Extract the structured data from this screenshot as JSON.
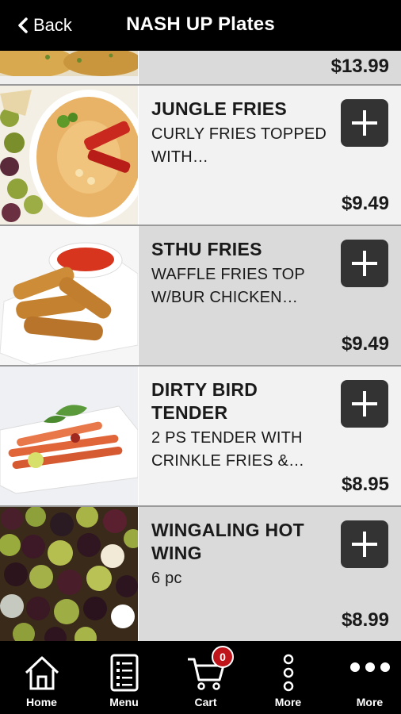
{
  "header": {
    "back_label": "Back",
    "title": "NASH UP Plates"
  },
  "items": [
    {
      "name": "",
      "description": "",
      "price": "$13.99"
    },
    {
      "name": "JUNGLE FRIES",
      "description": "CURLY FRIES TOPPED WITH…",
      "price": "$9.49"
    },
    {
      "name": "STHU FRIES",
      "description": "WAFFLE FRIES TOP W/BUR CHICKEN…",
      "price": "$9.49"
    },
    {
      "name": "DIRTY BIRD TENDER",
      "description": "2 PS TENDER WITH CRINKLE FRIES &…",
      "price": "$8.95"
    },
    {
      "name": "WINGALING HOT WING",
      "description": "6 pc",
      "price": "$8.99"
    }
  ],
  "nav": {
    "home": "Home",
    "menu": "Menu",
    "cart": "Cart",
    "cart_count": "0",
    "more1": "More",
    "more2": "More"
  },
  "icons": {
    "back": "chevron-left-icon",
    "add": "plus-icon",
    "home": "home-icon",
    "menu": "menu-list-icon",
    "cart": "cart-icon",
    "more_vertical": "more-vertical-icon",
    "more_horizontal": "more-horizontal-icon"
  },
  "colors": {
    "header_bg": "#000000",
    "badge": "#c0141b",
    "add_button": "#333333"
  }
}
